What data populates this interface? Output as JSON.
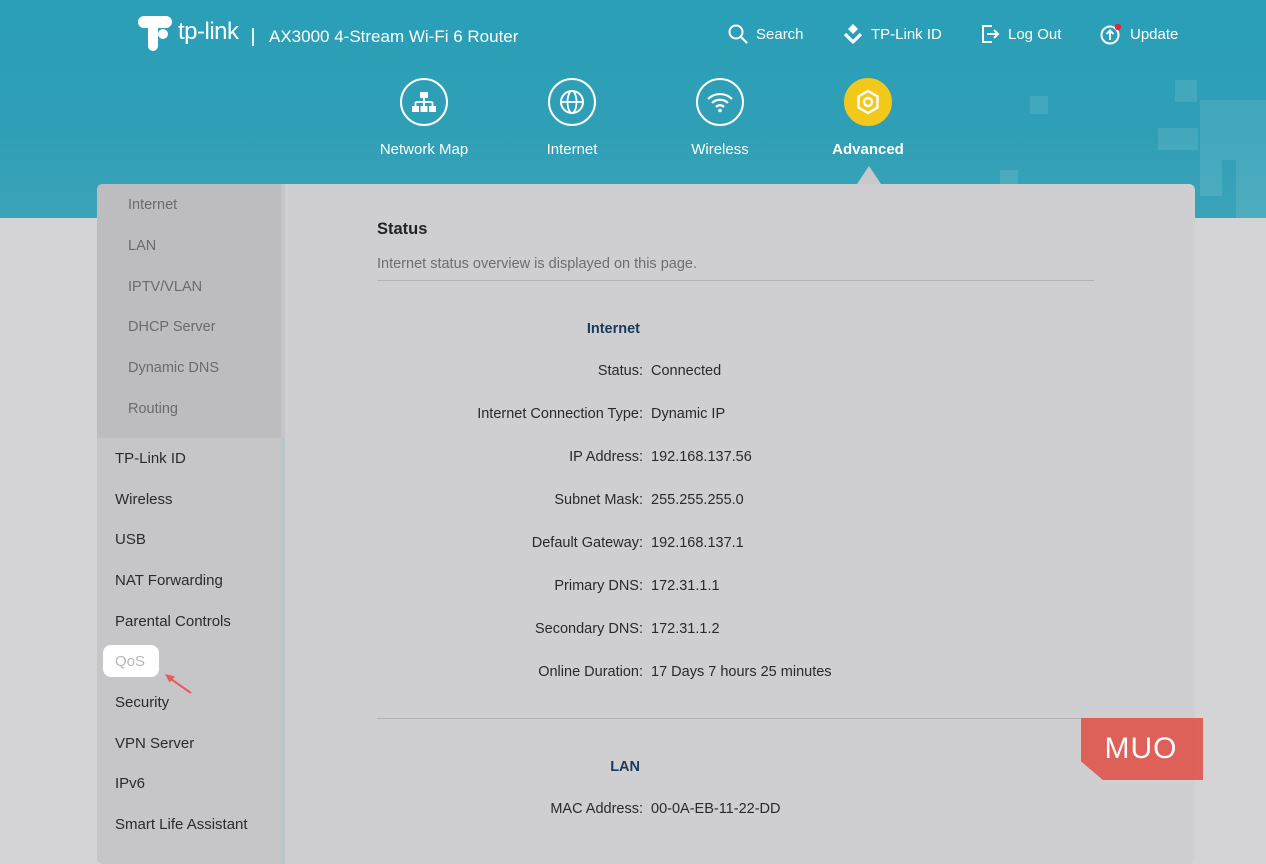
{
  "brand": {
    "logo_text": "tp-link",
    "product": "AX3000 4-Stream Wi-Fi 6 Router"
  },
  "top_links": [
    {
      "label": "Search",
      "icon": "search-icon"
    },
    {
      "label": "TP-Link ID",
      "icon": "tplink-id-icon"
    },
    {
      "label": "Log Out",
      "icon": "logout-icon"
    },
    {
      "label": "Update",
      "icon": "update-icon"
    }
  ],
  "nav_tabs": [
    {
      "label": "Network Map",
      "icon": "network-map-icon",
      "active": false
    },
    {
      "label": "Internet",
      "icon": "globe-icon",
      "active": false
    },
    {
      "label": "Wireless",
      "icon": "wifi-icon",
      "active": false
    },
    {
      "label": "Advanced",
      "icon": "gear-icon",
      "active": true
    }
  ],
  "sidebar": {
    "sub_items": [
      "Internet",
      "LAN",
      "IPTV/VLAN",
      "DHCP Server",
      "Dynamic DNS",
      "Routing"
    ],
    "items": [
      "TP-Link ID",
      "Wireless",
      "USB",
      "NAT Forwarding",
      "Parental Controls",
      "QoS",
      "Security",
      "VPN Server",
      "IPv6",
      "Smart Life Assistant"
    ]
  },
  "content": {
    "title": "Status",
    "description": "Internet status overview is displayed on this page.",
    "internet_section": "Internet",
    "internet_rows": [
      {
        "key": "Status:",
        "value": "Connected"
      },
      {
        "key": "Internet Connection Type:",
        "value": "Dynamic IP"
      },
      {
        "key": "IP Address:",
        "value": "192.168.137.56"
      },
      {
        "key": "Subnet Mask:",
        "value": "255.255.255.0"
      },
      {
        "key": "Default Gateway:",
        "value": "192.168.137.1"
      },
      {
        "key": "Primary DNS:",
        "value": "172.31.1.1"
      },
      {
        "key": "Secondary DNS:",
        "value": "172.31.1.2"
      },
      {
        "key": "Online Duration:",
        "value": "17 Days 7 hours 25 minutes"
      }
    ],
    "lan_section": "LAN",
    "lan_rows": [
      {
        "key": "MAC Address:",
        "value": "00-0A-EB-11-22-DD"
      }
    ]
  },
  "watermark": "MUO",
  "colors": {
    "header": "#2a9fb8",
    "active_tab": "#f2c81b",
    "watermark": "#e0584f",
    "section_heading": "#183a5a"
  }
}
